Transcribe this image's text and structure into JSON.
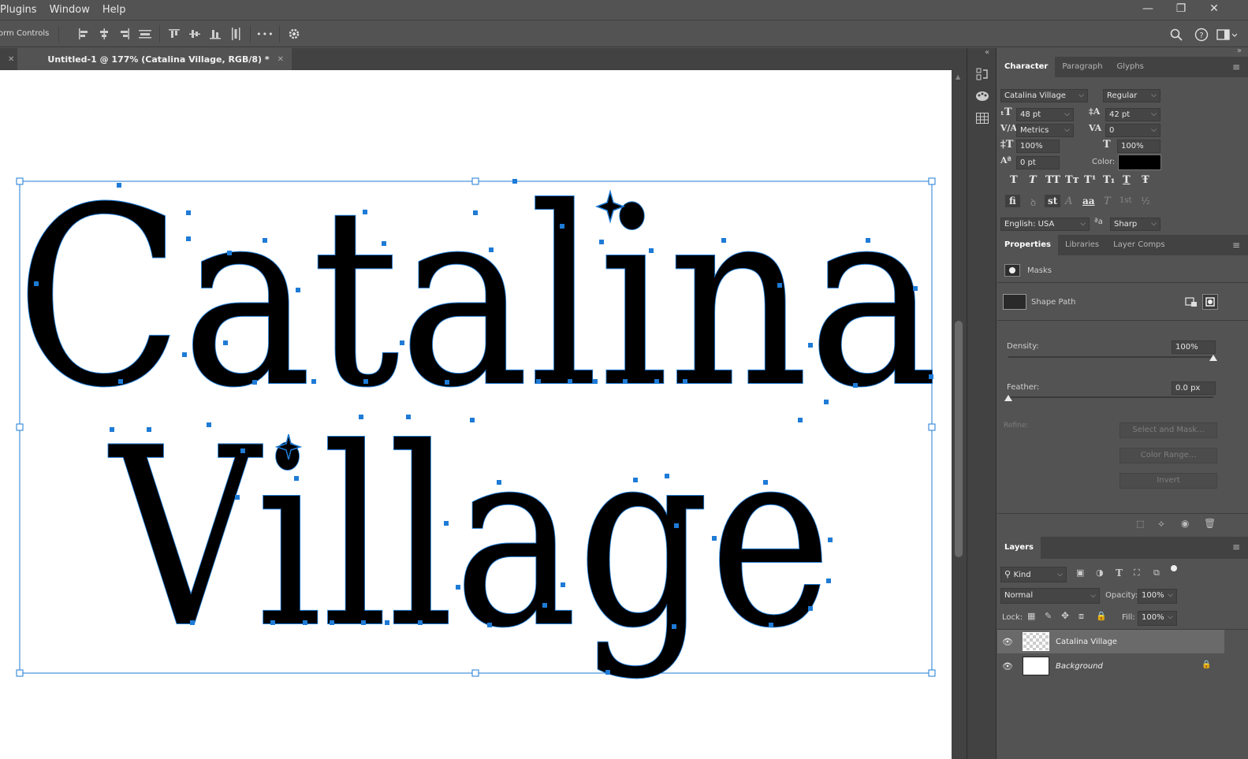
{
  "menu": [
    "Plugins",
    "Window",
    "Help"
  ],
  "window_controls": {
    "minimize": "—",
    "restore": "❐",
    "close": "✕"
  },
  "options_bar": {
    "form_controls": "orm Controls",
    "more": "•••"
  },
  "tabs": [
    {
      "label": "",
      "close": "✕"
    },
    {
      "label": "Untitled-1 @ 177% (Catalina Village, RGB/8) *",
      "close": "✕"
    }
  ],
  "canvas": {
    "line1": "Catalina",
    "line2": "Village",
    "text_color": "#000000",
    "path_color": "#1e7bd6"
  },
  "character_panel": {
    "tabs": [
      "Character",
      "Paragraph",
      "Glyphs"
    ],
    "font_family": "Catalina Village",
    "font_style": "Regular",
    "font_size": "48 pt",
    "leading": "42 pt",
    "kerning": "Metrics",
    "tracking": "0",
    "vertical_scale": "100%",
    "horizontal_scale": "100%",
    "baseline_shift": "0 pt",
    "color_label": "Color:",
    "color_value": "#000000",
    "type_styles": [
      "T",
      "T",
      "TT",
      "Tт",
      "T¹",
      "T₁",
      "T",
      "Ŧ"
    ],
    "opentype": [
      "fi",
      "ꝺ",
      "st",
      "A",
      "aa",
      "T",
      "1st",
      "½"
    ],
    "language": "English: USA",
    "aa_label": "ªa",
    "antialias": "Sharp"
  },
  "properties_panel": {
    "tabs": [
      "Properties",
      "Libraries",
      "Layer Comps"
    ],
    "masks_label": "Masks",
    "shape_path_label": "Shape Path",
    "density_label": "Density:",
    "density_value": "100%",
    "density_fraction": 1.0,
    "feather_label": "Feather:",
    "feather_value": "0.0 px",
    "feather_fraction": 0.0,
    "refine_label": "Refine:",
    "buttons": [
      "Select and Mask...",
      "Color Range...",
      "Invert"
    ]
  },
  "layers_panel": {
    "title": "Layers",
    "filter_kind": "Kind",
    "blend_mode": "Normal",
    "opacity_label": "Opacity:",
    "opacity_value": "100%",
    "lock_label": "Lock:",
    "fill_label": "Fill:",
    "fill_value": "100%",
    "layers": [
      {
        "name": "Catalina Village",
        "selected": true,
        "visible": true
      },
      {
        "name": "Background",
        "selected": false,
        "visible": true,
        "locked": true
      }
    ]
  }
}
